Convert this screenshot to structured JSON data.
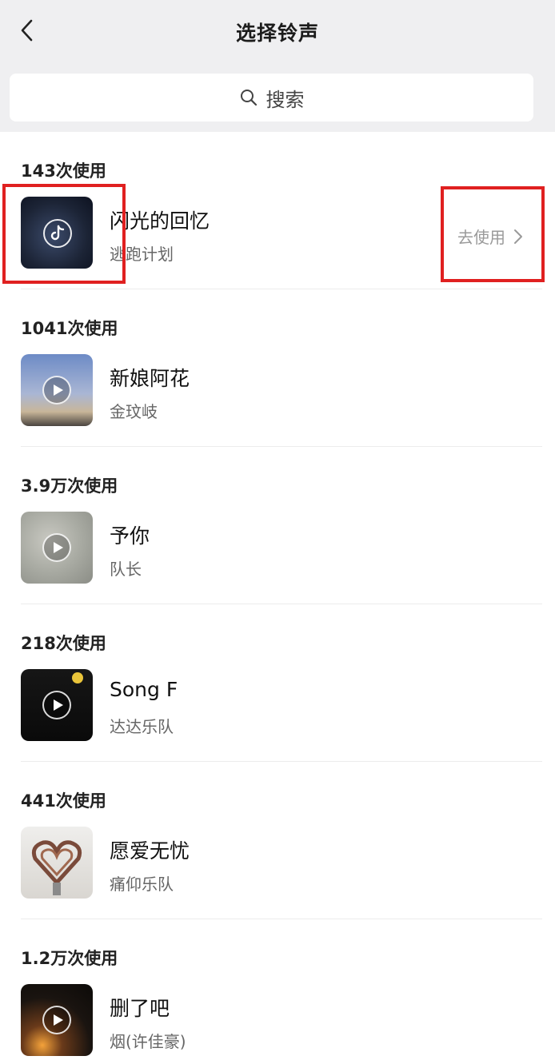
{
  "header": {
    "title": "选择铃声",
    "back_icon": "chevron-left-icon"
  },
  "search": {
    "placeholder": "搜索",
    "icon": "search-icon"
  },
  "ringtones": [
    {
      "count": "143次使用",
      "title": "闪光的回忆",
      "artist": "逃跑计划",
      "use_label": "去使用"
    },
    {
      "count": "1041次使用",
      "title": "新娘阿花",
      "artist": "金玟岐"
    },
    {
      "count": "3.9万次使用",
      "title": "予你",
      "artist": "队长"
    },
    {
      "count": "218次使用",
      "title": "Song F",
      "artist": "达达乐队"
    },
    {
      "count": "441次使用",
      "title": "愿爱无忧",
      "artist": "痛仰乐队"
    },
    {
      "count": "1.2万次使用",
      "title": "删了吧",
      "artist": "烟(许佳豪)"
    }
  ],
  "colors": {
    "header_bg": "#efeff1",
    "highlight_red": "#e02020",
    "muted_text": "#9a9a9a"
  }
}
